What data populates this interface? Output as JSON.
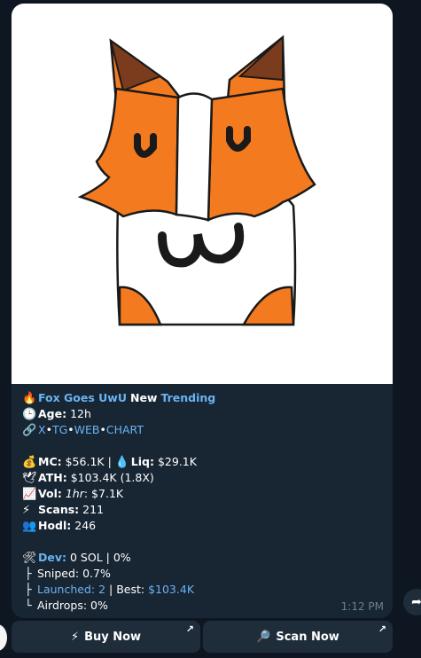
{
  "message": {
    "title_line": {
      "icon": "fire-icon",
      "token_name": "Fox Goes UwU",
      "new_label": "New",
      "trending_label": "Trending"
    },
    "age": {
      "icon": "clock-icon",
      "label": "Age:",
      "value": "12h"
    },
    "links": {
      "icon": "link-icon",
      "x": "X",
      "tg": "TG",
      "web": "WEB",
      "chart": "CHART",
      "separator": "•"
    },
    "mc": {
      "icon": "moneybag-icon",
      "label": "MC:",
      "value": "$56.1K",
      "divider": "|"
    },
    "liq": {
      "icon": "droplet-icon",
      "label": "Liq:",
      "value": "$29.1K"
    },
    "ath": {
      "icon": "dove-icon",
      "label": "ATH:",
      "value": "$103.4K (1.8X)"
    },
    "vol": {
      "icon": "chart-up-icon",
      "label": "Vol:",
      "period": "1hr",
      "value": ": $7.1K"
    },
    "scans": {
      "icon": "lightning-icon",
      "label": "Scans:",
      "value": "211"
    },
    "hodl": {
      "icon": "people-icon",
      "label": "Hodl:",
      "value": "246"
    },
    "dev": {
      "icon": "tools-icon",
      "label": "Dev:",
      "value": "0 SOL | 0%"
    },
    "sniped": {
      "label": "Sniped:",
      "value": "0.7%"
    },
    "launched": {
      "label": "Launched: 2",
      "divider": "| Best:",
      "best": "$103.4K"
    },
    "airdrops": {
      "label": "Airdrops:",
      "value": "0%"
    },
    "time": "1:12 PM"
  },
  "buttons": {
    "buy": {
      "label": "Buy Now",
      "icon": "lightning-icon",
      "corner": "↗"
    },
    "scan": {
      "label": "Scan Now",
      "icon": "magnifier-icon",
      "corner": "↗"
    }
  },
  "colors": {
    "background": "#0e1621",
    "bubble": "#182533",
    "link": "#6ab3f3",
    "fox_orange": "#f47a20",
    "fox_ear": "#7a3c1c"
  }
}
